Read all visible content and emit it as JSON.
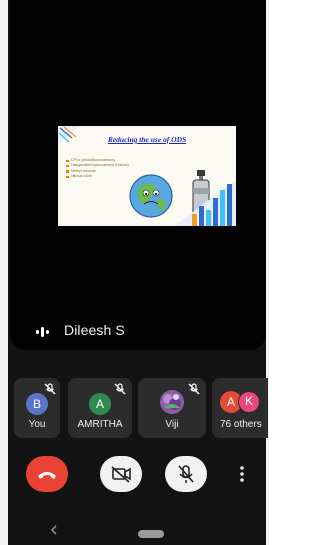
{
  "presentation": {
    "title": "Reducing the use of ODS",
    "bullets": [
      "CFCs (chlorofluorocarbons)",
      "Halogenated hydrocarbons (Halons)",
      "Methyl bromide",
      "Nitrous oxide"
    ]
  },
  "active_speaker": {
    "name": "Dileesh S"
  },
  "participants": [
    {
      "name": "You",
      "initial": "B",
      "avatar_color": "#5a75c8",
      "muted": true
    },
    {
      "name": "AMRITHA",
      "initial": "A",
      "avatar_color": "#2e8a4e",
      "muted": true
    },
    {
      "name": "Viji",
      "muted": true,
      "avatar": "photo"
    },
    {
      "name": "76 others",
      "initials": [
        "A",
        "K"
      ],
      "avatar_colors": [
        "#e34b36",
        "#e8467c"
      ]
    }
  ],
  "controls": [
    "end-call",
    "camera-off",
    "microphone-off",
    "more-options"
  ],
  "colors": {
    "hangup": "#ea4335",
    "tile": "#2c2c2c",
    "background": "#121212"
  }
}
